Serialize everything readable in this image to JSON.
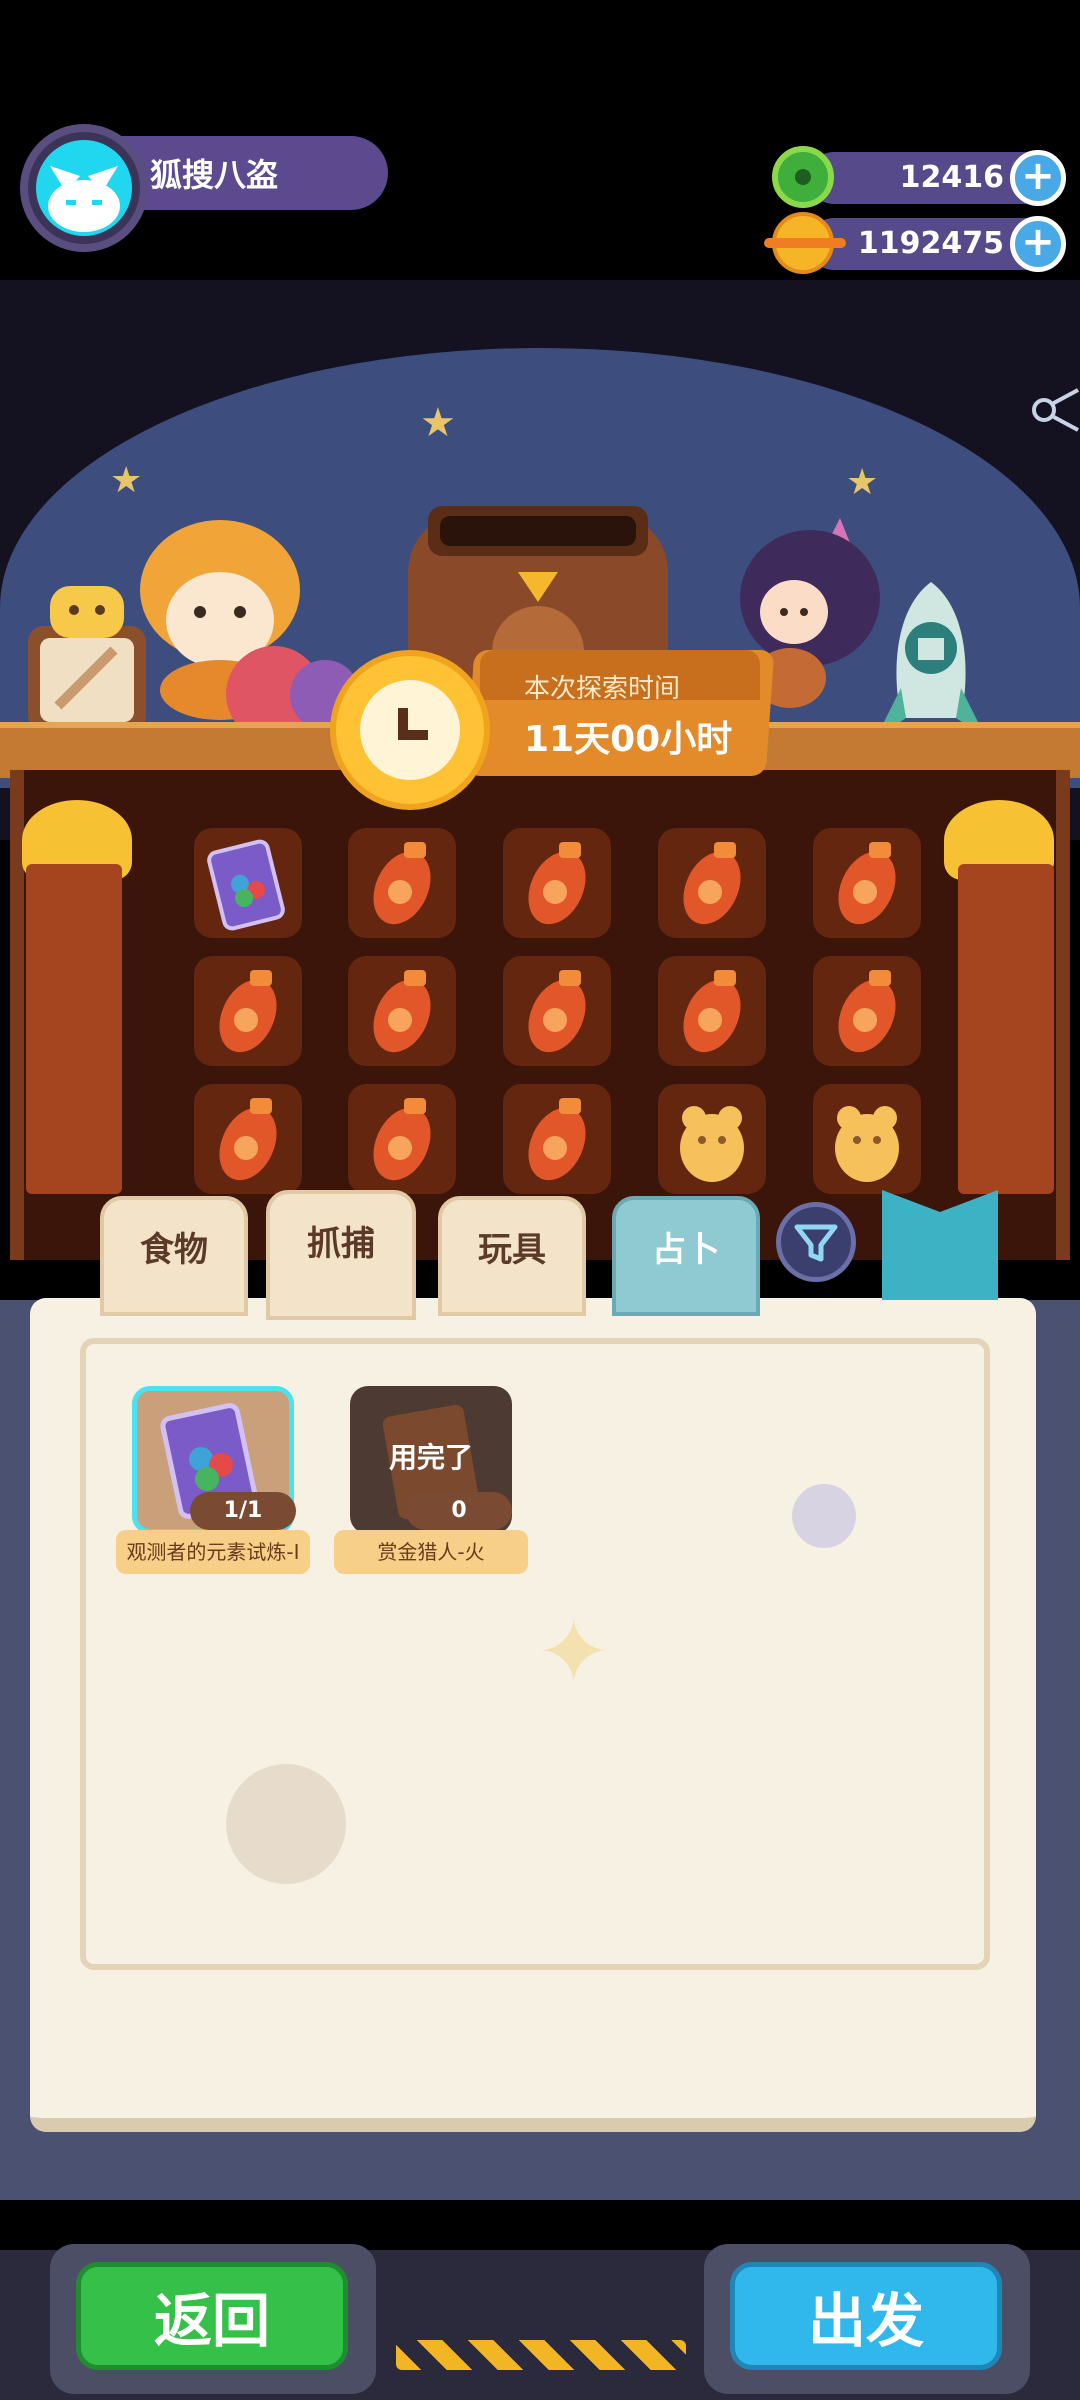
{
  "player": {
    "name": "狐搜八盗"
  },
  "currencies": [
    {
      "icon": "donut-coin-icon",
      "value": "12416",
      "add_label": "+"
    },
    {
      "icon": "planet-coin-icon",
      "value": "1192475",
      "add_label": "+"
    }
  ],
  "timer": {
    "label": "本次探索时间",
    "value": "11天00小时"
  },
  "tabs": [
    {
      "label": "食物"
    },
    {
      "label": "抓捕"
    },
    {
      "label": "玩具"
    },
    {
      "label": "占卜"
    }
  ],
  "cards": [
    {
      "name": "观测者的元素试炼-I",
      "count": "1/1",
      "status": ""
    },
    {
      "name": "赏金猎人-火",
      "count": "0",
      "status": "用完了"
    }
  ],
  "buttons": {
    "back": "返回",
    "go": "出发"
  },
  "colors": {
    "back_button": "#35c04a",
    "go_button": "#30b8ec",
    "selected_tab": "#8fc9d1",
    "timer_ribbon": "#e38a2a"
  }
}
